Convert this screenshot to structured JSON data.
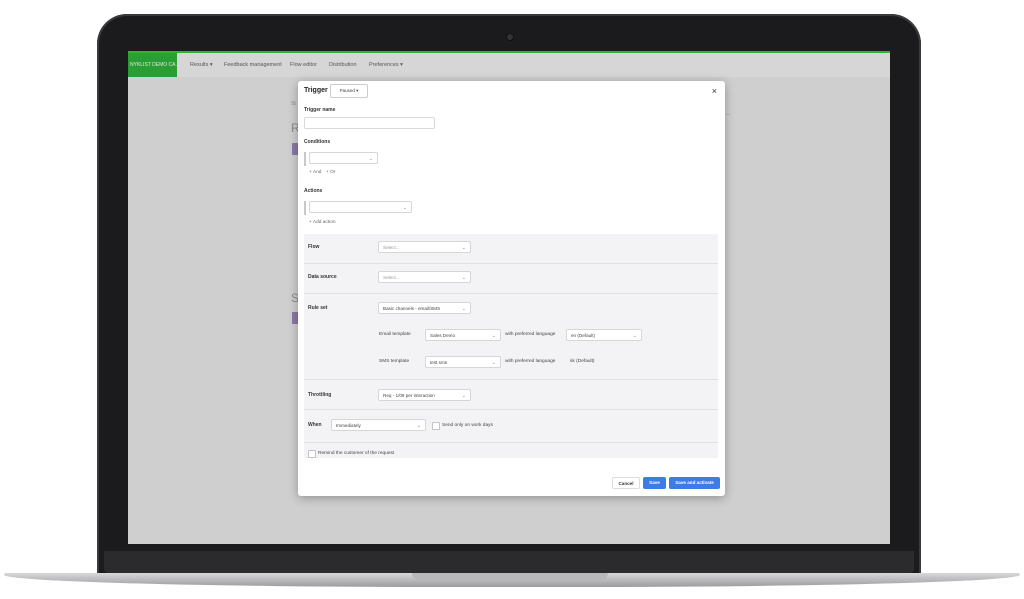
{
  "nav": {
    "brand": "NYKLIST DEMO CA...",
    "items": [
      "Results ▾",
      "Feedback management",
      "Flow editor",
      "Distribution",
      "Preferences ▾"
    ]
  },
  "background": {
    "frag1": "St",
    "frag2": "R",
    "frag3": "S"
  },
  "modal": {
    "title": "Trigger",
    "status": "Paused ▾",
    "close": "×",
    "trigger_name_label": "Trigger name",
    "trigger_name_value": "",
    "conditions_label": "Conditions",
    "condition_select": "",
    "and_link": "+ And",
    "or_link": "+ Or",
    "actions_label": "Actions",
    "action_select": "",
    "add_action_link": "+ Add action",
    "flow": {
      "label": "Flow",
      "placeholder": "Select..."
    },
    "data_source": {
      "label": "Data source",
      "placeholder": "Select..."
    },
    "rule_set": {
      "label": "Rule set",
      "value": "Basic channels - email/SMS",
      "email_template_label": "Email template",
      "email_template_value": "Sales Demo",
      "email_pref_lang_label": "with preferred language",
      "email_lang_value": "en (Default)",
      "sms_template_label": "SMS template",
      "sms_template_value": "test sms",
      "sms_pref_lang_label": "with preferred language",
      "sms_lang_value": "sk (Default)"
    },
    "throttling": {
      "label": "Throttling",
      "value": "Req - 1/09 per interaction"
    },
    "when": {
      "label": "When",
      "value": "Immediately",
      "workdays_label": "Send only on work days"
    },
    "remind_label": "Remind the customer of the request",
    "buttons": {
      "cancel": "Cancel",
      "save": "Save",
      "save_activate": "Save and activate"
    }
  },
  "colors": {
    "accent_green": "#2db23a",
    "primary_blue": "#3d7be8"
  }
}
